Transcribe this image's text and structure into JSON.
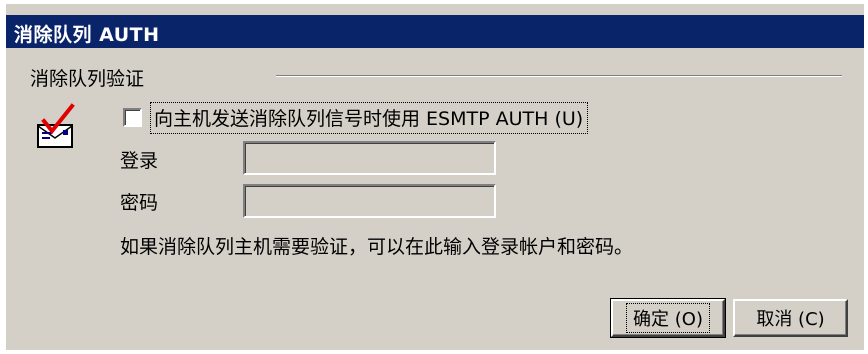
{
  "window": {
    "title": "消除队列 AUTH"
  },
  "group": {
    "label": "消除队列验证"
  },
  "auth_checkbox": {
    "label": "向主机发送消除队列信号时使用 ESMTP AUTH (U)",
    "checked": false
  },
  "login": {
    "label": "登录",
    "value": ""
  },
  "password": {
    "label": "密码",
    "value": ""
  },
  "info_text": "如果消除队列主机需要验证，可以在此输入登录帐户和密码。",
  "buttons": {
    "ok": "确定 (O)",
    "cancel": "取消 (C)"
  },
  "colors": {
    "titlebar": "#0a246a",
    "dialog_bg": "#d4d0c8",
    "check_mark": "#e00000"
  },
  "icons": {
    "mail": "mail-check-icon"
  }
}
